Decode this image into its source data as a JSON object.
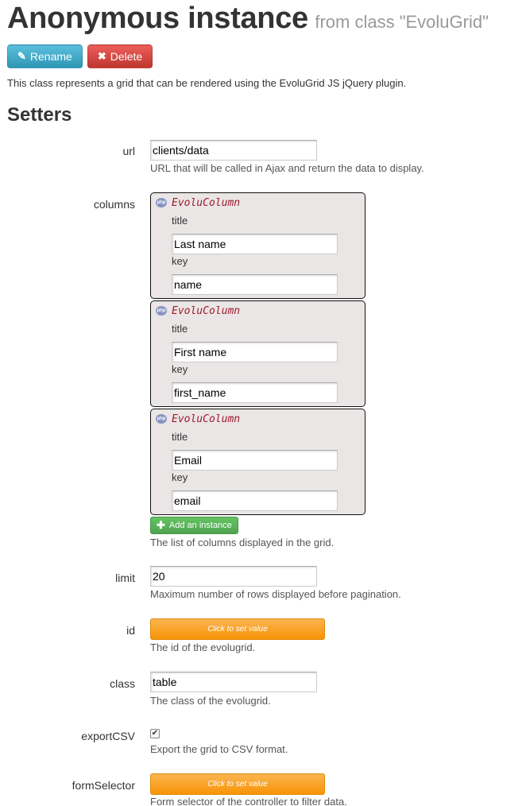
{
  "header": {
    "title": "Anonymous instance",
    "subtitle": "from class \"EvoluGrid\""
  },
  "actions": {
    "rename_label": "Rename",
    "delete_label": "Delete"
  },
  "description": "This class represents a grid that can be rendered using the EvoluGrid JS jQuery plugin.",
  "section_title": "Setters",
  "setters": {
    "url": {
      "label": "url",
      "value": "clients/data",
      "help": "URL that will be called in Ajax and return the data to display."
    },
    "columns": {
      "label": "columns",
      "instances": [
        {
          "class_name": "EvoluColumn",
          "title_label": "title",
          "title_value": "Last name",
          "key_label": "key",
          "key_value": "name"
        },
        {
          "class_name": "EvoluColumn",
          "title_label": "title",
          "title_value": "First name",
          "key_label": "key",
          "key_value": "first_name"
        },
        {
          "class_name": "EvoluColumn",
          "title_label": "title",
          "title_value": "Email",
          "key_label": "key",
          "key_value": "email"
        }
      ],
      "add_label": "Add an instance",
      "help": "The list of columns displayed in the grid."
    },
    "limit": {
      "label": "limit",
      "value": "20",
      "help": "Maximum number of rows displayed before pagination."
    },
    "id": {
      "label": "id",
      "button_label": "Click to set value",
      "help": "The id of the evolugrid."
    },
    "class": {
      "label": "class",
      "value": "table",
      "help": "The class of the evolugrid."
    },
    "exportCSV": {
      "label": "exportCSV",
      "checked": true,
      "check_glyph": "✔",
      "help": "Export the grid to CSV format."
    },
    "formSelector": {
      "label": "formSelector",
      "button_label": "Click to set value",
      "help": "Form selector of the controller to filter data."
    }
  },
  "icons": {
    "rename": "pencil-icon",
    "delete": "times-icon",
    "add": "plus-icon",
    "php": "php-icon"
  },
  "colors": {
    "rename_button": "#49afcd",
    "delete_button": "#da4f49",
    "add_button": "#5bb75b",
    "set_value_button": "#faa732",
    "class_name_text": "#9c1a2e"
  }
}
